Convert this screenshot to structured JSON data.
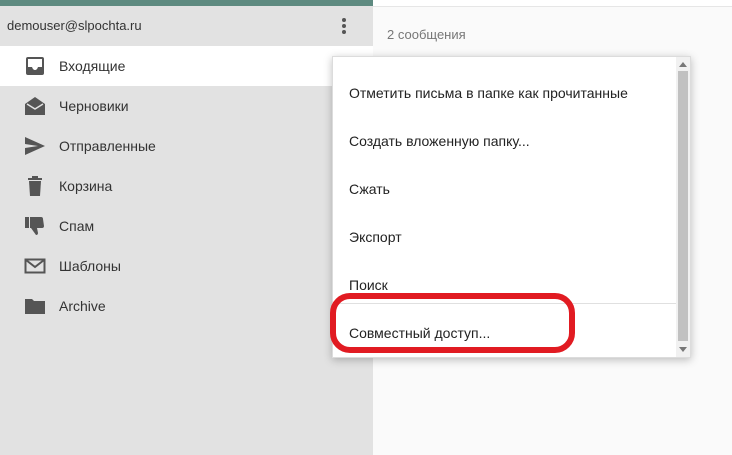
{
  "account": {
    "email": "demouser@slpochta.ru",
    "menu_icon": "kebab-menu-icon"
  },
  "folders": [
    {
      "label": "Входящие",
      "icon": "inbox-icon",
      "active": true
    },
    {
      "label": "Черновики",
      "icon": "drafts-icon"
    },
    {
      "label": "Отправленные",
      "icon": "send-icon"
    },
    {
      "label": "Корзина",
      "icon": "trash-icon"
    },
    {
      "label": "Спам",
      "icon": "thumbs-down-icon"
    },
    {
      "label": "Шаблоны",
      "icon": "envelope-icon"
    },
    {
      "label": "Archive",
      "icon": "folder-icon"
    }
  ],
  "content": {
    "message_count": "2 сообщения"
  },
  "context_menu": {
    "items": [
      "Отметить письма в папке как прочитанные",
      "Создать вложенную папку...",
      "Сжать",
      "Экспорт",
      "Поиск",
      "Совместный доступ..."
    ]
  },
  "colors": {
    "highlight": "#e11b22",
    "topbar": "#5e8a80",
    "sidebar_bg": "#e2e2e2"
  }
}
